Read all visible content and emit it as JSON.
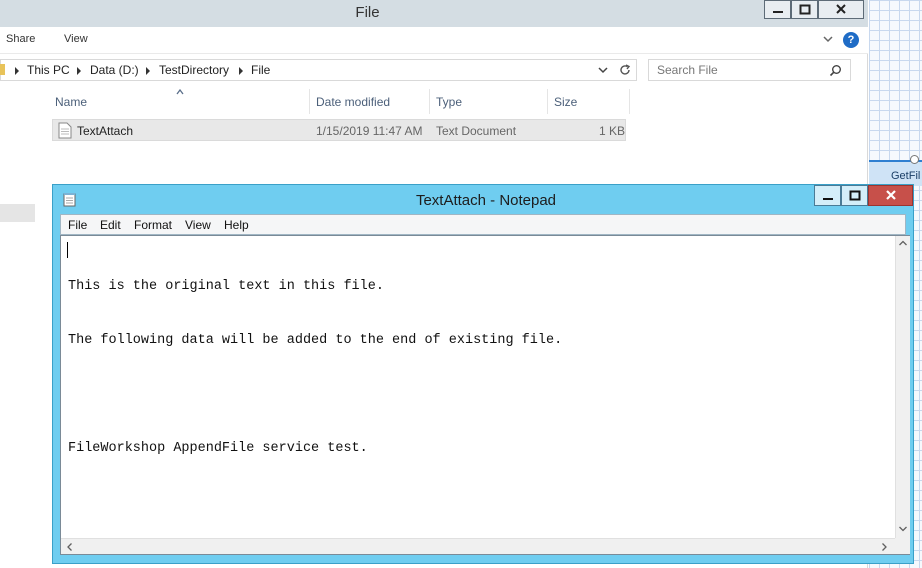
{
  "explorer": {
    "title": "File",
    "ribbon": {
      "tabs": [
        "Share",
        "View"
      ],
      "help": "?"
    },
    "breadcrumb": [
      "This PC",
      "Data (D:)",
      "TestDirectory",
      "File"
    ],
    "search": {
      "placeholder": "Search File"
    },
    "columns": {
      "name": "Name",
      "date_modified": "Date modified",
      "type": "Type",
      "size": "Size"
    },
    "files": [
      {
        "name": "TextAttach",
        "date_modified": "1/15/2019 11:47 AM",
        "type": "Text Document",
        "size": "1 KB"
      }
    ]
  },
  "background": {
    "node_label": "GetFil"
  },
  "notepad": {
    "title": "TextAttach - Notepad",
    "menu": [
      "File",
      "Edit",
      "Format",
      "View",
      "Help"
    ],
    "lines": [
      "This is the original text in this file.",
      "The following data will be added to the end of existing file.",
      "",
      "FileWorkshop AppendFile service test."
    ]
  },
  "colors": {
    "notepad_frame": "#6fcdf0",
    "close_button": "#c7504a",
    "explorer_titlebar": "#d4dde3",
    "accent_blue": "#1f6cc6"
  },
  "icons": [
    "minimize-icon",
    "maximize-icon",
    "close-icon",
    "help-icon",
    "chevron-down-icon",
    "refresh-icon",
    "search-icon",
    "text-file-icon",
    "notepad-icon",
    "scroll-up-icon",
    "scroll-down-icon",
    "scroll-left-icon",
    "scroll-right-icon"
  ]
}
